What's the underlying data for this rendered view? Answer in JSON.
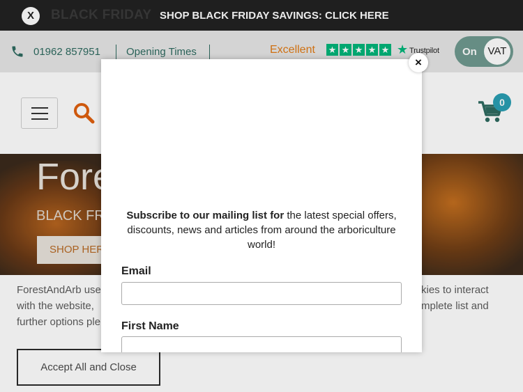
{
  "promo_bar": {
    "dismiss_label": "X",
    "faded_logo_text": "BLACK FRIDAY",
    "promo_text": "SHOP BLACK FRIDAY SAVINGS: CLICK HERE"
  },
  "info_bar": {
    "phone_icon": "phone-icon",
    "phone_number": "01962 857951",
    "opening_times_label": "Opening Times",
    "rating_word": "Excellent",
    "rating_stars": 5,
    "trustpilot_label": "Trustpilot",
    "vat_toggle": {
      "state_label": "On",
      "knob_label": "VAT"
    }
  },
  "header": {
    "menu_icon": "hamburger-menu-icon",
    "search_icon": "search-icon",
    "cart_icon": "shopping-cart-icon",
    "cart_count": "0"
  },
  "hero": {
    "heading_fragment": "Fore",
    "subheading_fragment": "BLACK FR",
    "cta_fragment": "SHOP HER"
  },
  "cookie_notice": {
    "left_text": "ForestAndArb use with the website, further options ple",
    "right_text": "kies to interact mplete list and",
    "accept_label": "Accept All and Close"
  },
  "newsletter_modal": {
    "close_label": "×",
    "intro_bold": "Subscribe to our mailing list for",
    "intro_rest": " the latest special offers, discounts, news and articles from around the arboriculture world!",
    "email_label": "Email",
    "email_value": "",
    "first_name_label": "First Name",
    "first_name_value": ""
  },
  "colors": {
    "brand_green": "#2e6b60",
    "accent_orange": "#e07a14",
    "trustpilot_green": "#00b67a",
    "cart_badge": "#2a9fb3",
    "top_bar": "#222222"
  }
}
